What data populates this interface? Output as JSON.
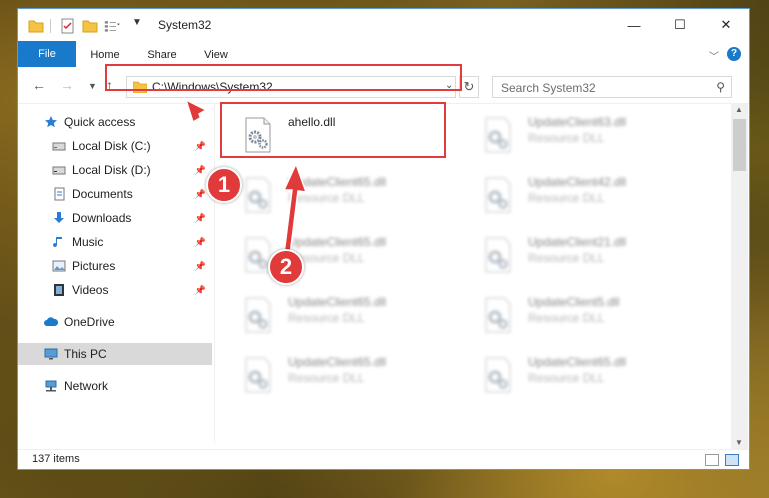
{
  "window": {
    "title": "System32",
    "controls": {
      "minimize": "—",
      "maximize": "☐",
      "close": "✕"
    }
  },
  "ribbon": {
    "tabs": [
      {
        "label": "File"
      },
      {
        "label": "Home"
      },
      {
        "label": "Share"
      },
      {
        "label": "View"
      }
    ],
    "help": "?"
  },
  "address": {
    "path": "C:\\Windows\\System32",
    "search_placeholder": "Search System32"
  },
  "sidebar": {
    "items": [
      {
        "label": "Quick access",
        "icon": "star-icon"
      },
      {
        "label": "Local Disk (C:)",
        "icon": "drive-icon",
        "pinned": true
      },
      {
        "label": "Local Disk (D:)",
        "icon": "drive-icon",
        "pinned": true
      },
      {
        "label": "Documents",
        "icon": "documents-icon",
        "pinned": true
      },
      {
        "label": "Downloads",
        "icon": "download-icon",
        "pinned": true
      },
      {
        "label": "Music",
        "icon": "music-icon",
        "pinned": true
      },
      {
        "label": "Pictures",
        "icon": "pictures-icon",
        "pinned": true
      },
      {
        "label": "Videos",
        "icon": "videos-icon",
        "pinned": true
      },
      {
        "label": "OneDrive",
        "icon": "cloud-icon"
      },
      {
        "label": "This PC",
        "icon": "monitor-icon",
        "selected": true
      },
      {
        "label": "Network",
        "icon": "network-icon"
      }
    ]
  },
  "files": [
    {
      "name": "ahello.dll",
      "type": ""
    },
    {
      "name": "UpdateClient63.dll",
      "type": "Resource DLL"
    },
    {
      "name": "UpdateClient65.dll",
      "type": "Resource DLL"
    },
    {
      "name": "UpdateClient42.dll",
      "type": "Resource DLL"
    },
    {
      "name": "UpdateClient65.dll",
      "type": "Resource DLL"
    },
    {
      "name": "UpdateClient21.dll",
      "type": "Resource DLL"
    },
    {
      "name": "UpdateClient65.dll",
      "type": "Resource DLL"
    },
    {
      "name": "UpdateClient5.dll",
      "type": "Resource DLL"
    },
    {
      "name": "UpdateClient65.dll",
      "type": "Resource DLL"
    },
    {
      "name": "UpdateClient65.dll",
      "type": "Resource DLL"
    }
  ],
  "status": {
    "item_count": "137 items"
  },
  "annotations": {
    "callout_1": "1",
    "callout_2": "2"
  },
  "colors": {
    "accent": "#1979ca",
    "annotation": "#e03a3a",
    "selected": "#d9d9d9"
  }
}
